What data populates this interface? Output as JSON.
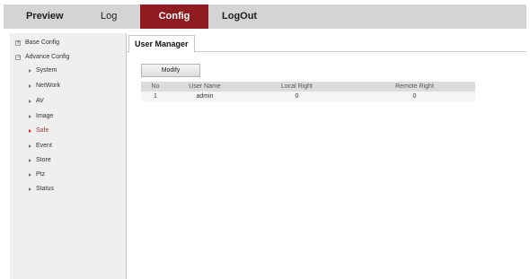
{
  "nav": {
    "preview": "Preview",
    "log": "Log",
    "config": "Config",
    "logout": "LogOut"
  },
  "sidebar": {
    "base_config": {
      "toggle": "+",
      "label": "Base Config"
    },
    "advance_config": {
      "toggle": "−",
      "label": "Advance Config"
    },
    "items": [
      {
        "label": "System"
      },
      {
        "label": "NetWork"
      },
      {
        "label": "AV"
      },
      {
        "label": "Image"
      },
      {
        "label": "Safe"
      },
      {
        "label": "Event"
      },
      {
        "label": "Store"
      },
      {
        "label": "Ptz"
      },
      {
        "label": "Status"
      }
    ],
    "active_item": "Safe"
  },
  "main": {
    "tab_label": "User Manager",
    "modify_label": "Modify",
    "table": {
      "headers": [
        "No",
        "User Name",
        "Local Right",
        "Remote Right"
      ],
      "rows": [
        [
          "1",
          "admin",
          "0",
          "0"
        ]
      ]
    }
  },
  "colors": {
    "accent": "#8e1c20",
    "active_item": "#d8262c",
    "topbar": "#d4d4d4",
    "sidebar": "#efefef"
  }
}
